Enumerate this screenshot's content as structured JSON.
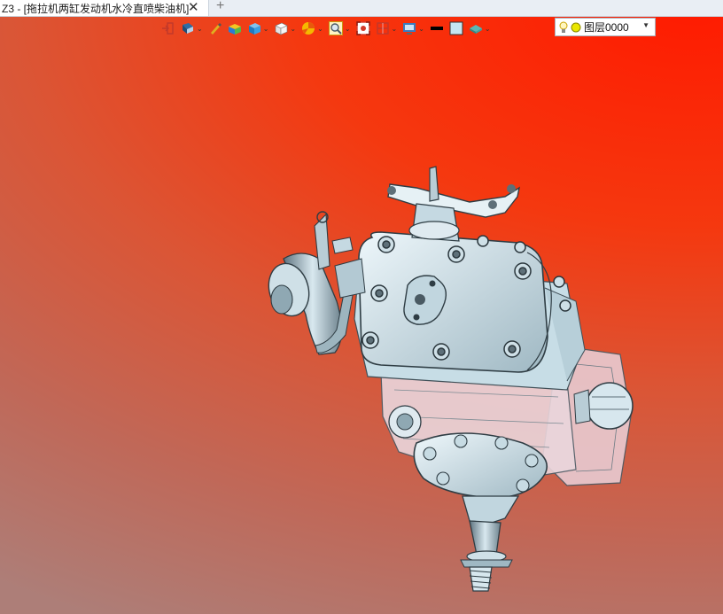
{
  "tab": {
    "title": "Z3 - [拖拉机两缸发动机水冷直喷柴油机]",
    "close_glyph": "✕",
    "add_glyph": "+"
  },
  "toolbar": {
    "tools": [
      {
        "icon": "exit-icon",
        "dropdown": false
      },
      {
        "icon": "view-orient-icon",
        "dropdown": true
      },
      {
        "icon": "pen-icon",
        "dropdown": false
      },
      {
        "icon": "shaded-box-icon",
        "dropdown": false
      },
      {
        "icon": "cube-blue-icon",
        "dropdown": true
      },
      {
        "icon": "cube-white-icon",
        "dropdown": true
      },
      {
        "icon": "render-style-icon",
        "dropdown": true
      },
      {
        "icon": "zoom-icon",
        "dropdown": true
      },
      {
        "icon": "zoom-extents-icon",
        "dropdown": false
      },
      {
        "icon": "section-icon",
        "dropdown": true
      },
      {
        "icon": "display-icon",
        "dropdown": true
      },
      {
        "icon": "line-color-icon",
        "dropdown": false
      },
      {
        "icon": "fill-color-icon",
        "dropdown": false
      },
      {
        "icon": "layer-style-icon",
        "dropdown": true
      }
    ],
    "chevron_glyph": "⌄"
  },
  "layer": {
    "value": "图层0000",
    "arrow_glyph": "▼"
  },
  "colors": {
    "viewport_top": "#ff1a00",
    "viewport_bottom": "#ad7e78",
    "engine_body": "#d2e6ee",
    "engine_dark": "#4a5a63",
    "crankcase_tint": "#e8c9cf"
  }
}
